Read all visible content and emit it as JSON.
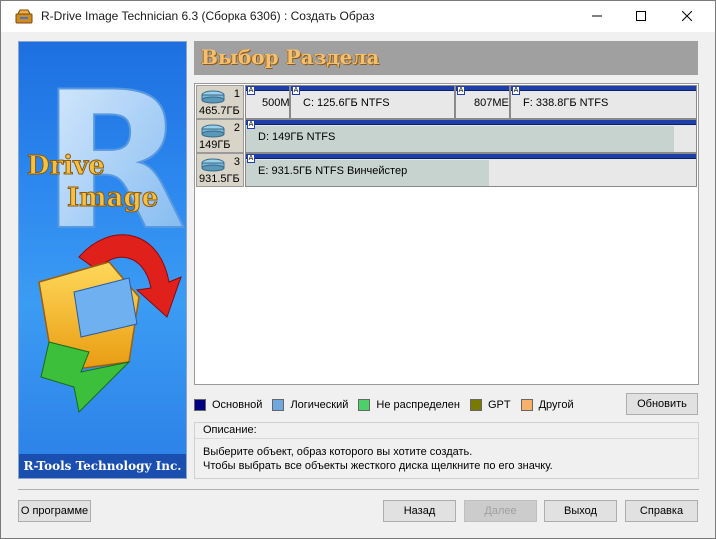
{
  "window": {
    "title": "R-Drive Image Technician 6.3 (Сборка 6306) : Создать Образ"
  },
  "banner": {
    "logo_r": "R",
    "logo_drive": "Drive",
    "logo_image": "Image",
    "footer": "R-Tools Technology Inc."
  },
  "header": {
    "title": "Выбор Раздела"
  },
  "disks": [
    {
      "num": "1",
      "size": "465.7ГБ",
      "partitions": [
        {
          "text": "500M",
          "fill": 0.0
        },
        {
          "text": "C:  125.6ГБ  NTFS",
          "fill": 0.0
        },
        {
          "text": "807ME",
          "fill": 0.0
        },
        {
          "text": "F:  338.8ГБ  NTFS",
          "fill": 0.0
        }
      ]
    },
    {
      "num": "2",
      "size": "149ГБ",
      "partitions": [
        {
          "text": "D:  149ГБ  NTFS",
          "fill": 0.95
        }
      ]
    },
    {
      "num": "3",
      "size": "931.5ГБ",
      "partitions": [
        {
          "text": "E:  931.5ГБ  NTFS  Винчейстер",
          "fill": 0.54
        }
      ]
    }
  ],
  "legend": [
    {
      "label": "Основной",
      "color": "#000080"
    },
    {
      "label": "Логический",
      "color": "#6fa8dc"
    },
    {
      "label": "Не распределен",
      "color": "#4cd06a"
    },
    {
      "label": "GPT",
      "color": "#7a7a00"
    },
    {
      "label": "Другой",
      "color": "#f6b26b"
    }
  ],
  "refresh_button": "Обновить",
  "description": {
    "title": "Описание:",
    "line1": "Выберите объект, образ которого вы хотите создать.",
    "line2": "Чтобы выбрать все объекты жесткого диска щелкните по его значку."
  },
  "footer": {
    "about": "О программе",
    "back": "Назад",
    "next": "Далее",
    "exit": "Выход",
    "help": "Справка"
  }
}
